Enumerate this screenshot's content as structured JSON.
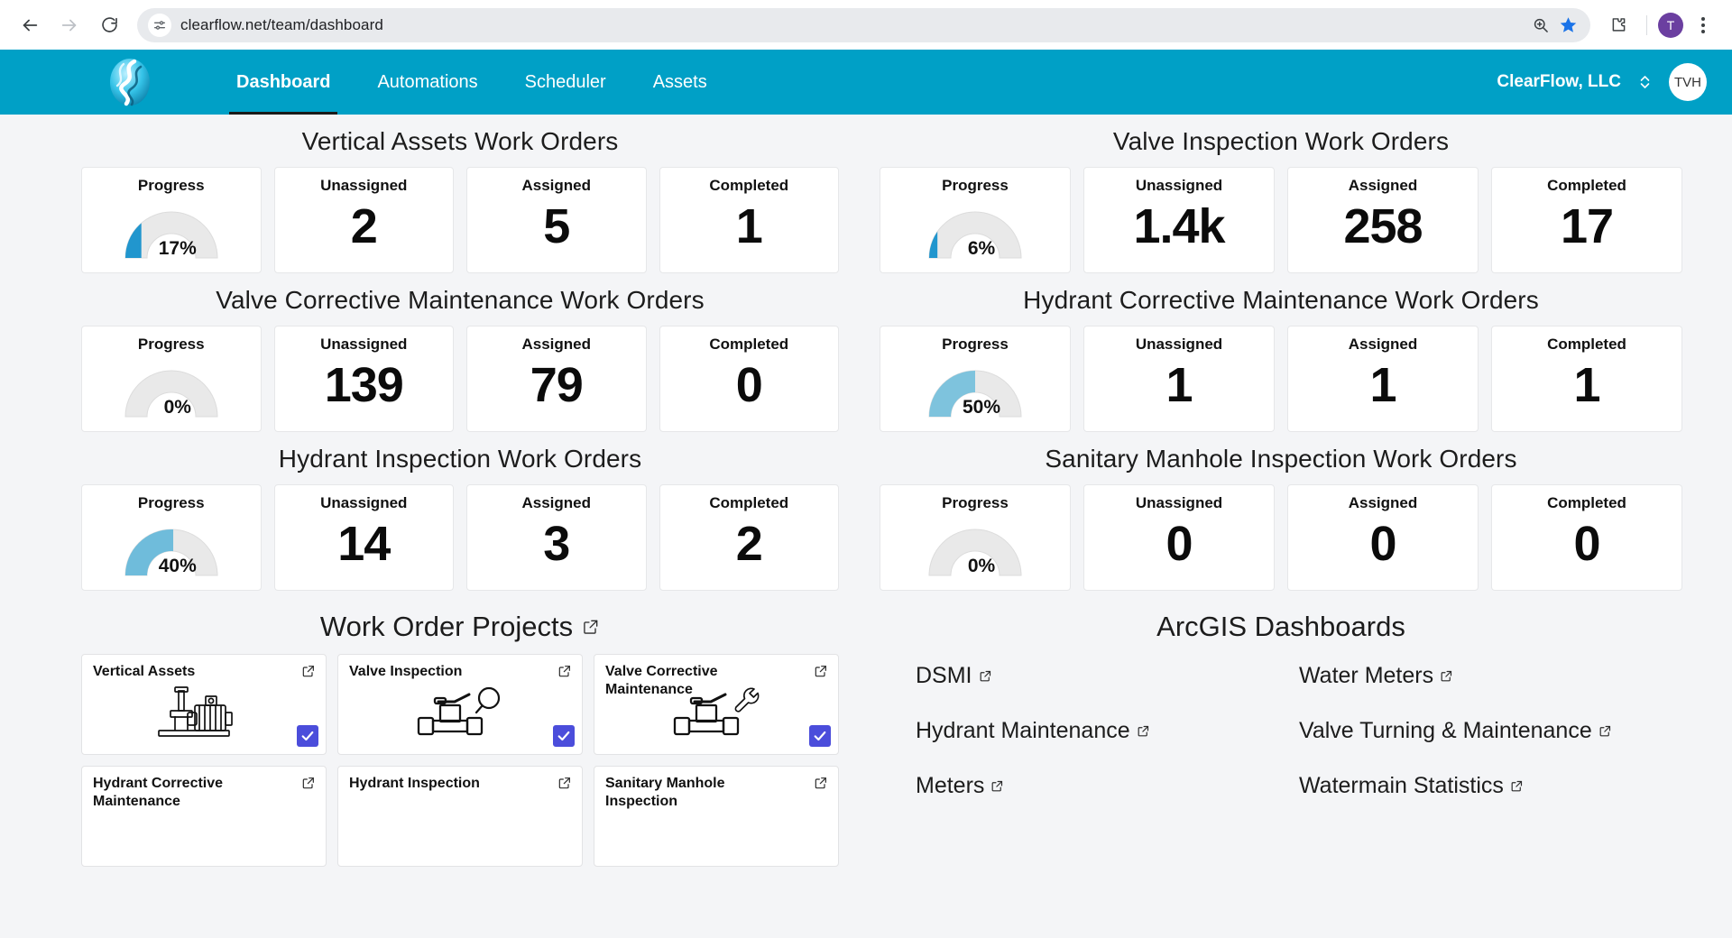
{
  "browser": {
    "url": "clearflow.net/team/dashboard",
    "back_icon": "back-arrow-icon",
    "forward_icon": "forward-arrow-icon",
    "reload_icon": "reload-icon",
    "site_info_icon": "site-settings-icon",
    "zoom_icon": "zoom-search-icon",
    "bookmark_icon": "bookmark-star-icon",
    "extensions_icon": "extensions-puzzle-icon",
    "profile_initial": "T",
    "menu_icon": "kebab-menu-icon"
  },
  "appnav": {
    "logo_name": "clearflow-logo",
    "links": [
      {
        "label": "Dashboard",
        "active": true
      },
      {
        "label": "Automations",
        "active": false
      },
      {
        "label": "Scheduler",
        "active": false
      },
      {
        "label": "Assets",
        "active": false
      }
    ],
    "org": "ClearFlow, LLC",
    "org_switch_icon": "up-down-chevron-icon",
    "user_initials": "TVH"
  },
  "kpi_labels": {
    "progress": "Progress",
    "unassigned": "Unassigned",
    "assigned": "Assigned",
    "completed": "Completed"
  },
  "groups": [
    {
      "title": "Vertical Assets Work Orders",
      "side": "left",
      "progress": "17%",
      "progress_value": 17,
      "progress_color": "#2196ce",
      "unassigned": "2",
      "assigned": "5",
      "completed": "1"
    },
    {
      "title": "Valve Inspection Work Orders",
      "side": "right",
      "progress": "6%",
      "progress_value": 6,
      "progress_color": "#2196ce",
      "unassigned": "1.4k",
      "assigned": "258",
      "completed": "17"
    },
    {
      "title": "Valve Corrective Maintenance Work Orders",
      "side": "left",
      "progress": "0%",
      "progress_value": 0,
      "progress_color": "#7ec3dd",
      "unassigned": "139",
      "assigned": "79",
      "completed": "0"
    },
    {
      "title": "Hydrant Corrective Maintenance Work Orders",
      "side": "right",
      "progress": "50%",
      "progress_value": 50,
      "progress_color": "#7ec3dd",
      "unassigned": "1",
      "assigned": "1",
      "completed": "1"
    },
    {
      "title": "Hydrant Inspection Work Orders",
      "side": "left",
      "progress": "40%",
      "progress_value": 40,
      "progress_color": "#6fbcdb",
      "unassigned": "14",
      "assigned": "3",
      "completed": "2"
    },
    {
      "title": "Sanitary Manhole Inspection Work Orders",
      "side": "right",
      "progress": "0%",
      "progress_value": 0,
      "progress_color": "#7ec3dd",
      "unassigned": "0",
      "assigned": "0",
      "completed": "0"
    }
  ],
  "projects_section": {
    "title": "Work Order Projects",
    "external_icon": "external-link-icon",
    "cards": [
      {
        "name": "Vertical Assets",
        "icon": "pump-motor-icon",
        "checked": true
      },
      {
        "name": "Valve Inspection",
        "icon": "valve-magnifier-icon",
        "checked": true
      },
      {
        "name": "Valve Corrective Maintenance",
        "icon": "valve-wrench-icon",
        "checked": true
      },
      {
        "name": "Hydrant Corrective Maintenance",
        "icon": "hydrant-wrench-icon",
        "checked": false
      },
      {
        "name": "Hydrant Inspection",
        "icon": "hydrant-magnifier-icon",
        "checked": false
      },
      {
        "name": "Sanitary Manhole Inspection",
        "icon": "manhole-magnifier-icon",
        "checked": false
      }
    ]
  },
  "arcgis_section": {
    "title": "ArcGIS Dashboards",
    "links": [
      "DSMI",
      "Water Meters",
      "Hydrant Maintenance",
      "Valve Turning & Maintenance",
      "Meters",
      "Watermain Statistics"
    ]
  },
  "colors": {
    "brand_blue": "#00a0c6",
    "page_bg": "#f4f5f7",
    "gauge_track": "#e6e6e6",
    "check_purple": "#4b4ddb"
  }
}
